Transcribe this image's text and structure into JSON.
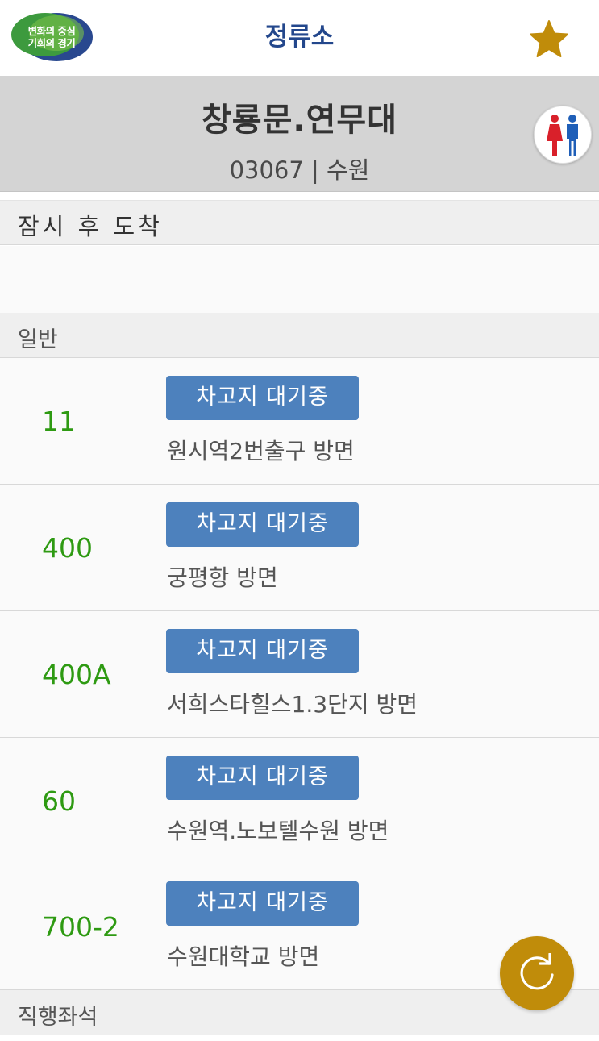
{
  "header": {
    "title": "정류소",
    "logo": {
      "line1": "변화의 중심",
      "line2": "기회의 경기"
    },
    "favorite_icon": "star-icon",
    "colors": {
      "title": "#23478c",
      "star": "#c08c0a"
    }
  },
  "stop": {
    "name": "창룡문.연무대",
    "meta": "03067 | 수원",
    "restroom_icon": "restroom-icon"
  },
  "sections": {
    "arriving_soon": "잠시 후 도착",
    "normal": "일반",
    "express": "직행좌석"
  },
  "routes": [
    {
      "number": "11",
      "status": "차고지 대기중",
      "direction": "원시역2번출구 방면"
    },
    {
      "number": "400",
      "status": "차고지 대기중",
      "direction": "궁평항 방면"
    },
    {
      "number": "400A",
      "status": "차고지 대기중",
      "direction": "서희스타힐스1.3단지 방면"
    },
    {
      "number": "60",
      "status": "차고지 대기중",
      "direction": "수원역.노보텔수원 방면"
    },
    {
      "number": "700-2",
      "status": "차고지 대기중",
      "direction": "수원대학교 방면"
    }
  ],
  "refresh_icon": "refresh-icon",
  "colors": {
    "route_number": "#2e9a12",
    "status_button": "#4d81bd",
    "refresh_button": "#c08c0a"
  }
}
